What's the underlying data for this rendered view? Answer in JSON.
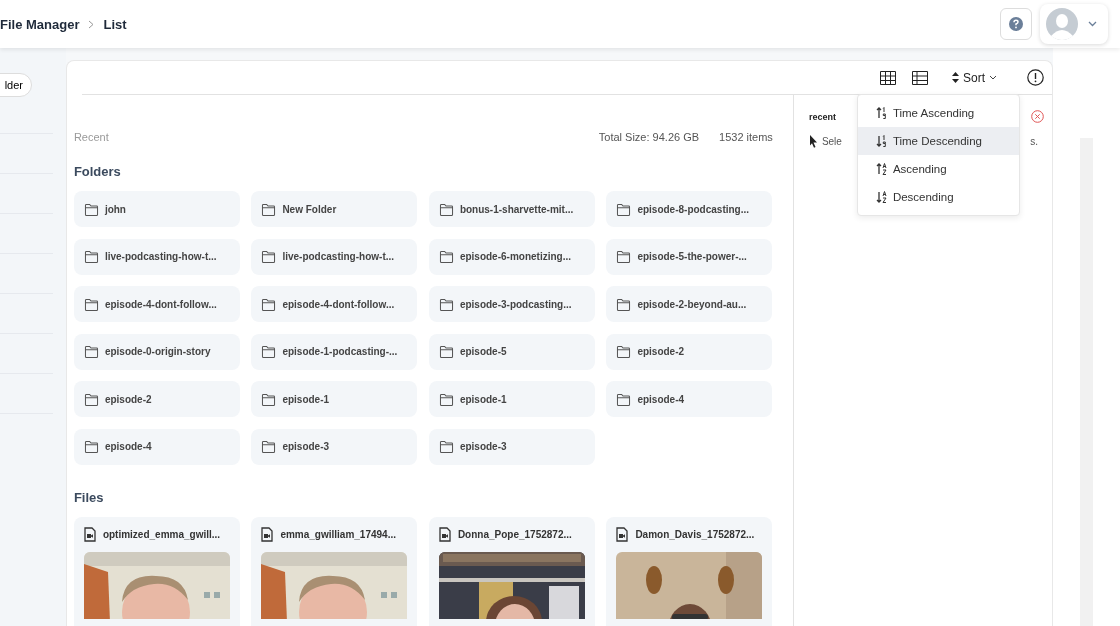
{
  "breadcrumb": [
    "File Manager",
    "List"
  ],
  "sidebar": {
    "new_button": "lder"
  },
  "toolbar": {
    "sort_label": "Sort"
  },
  "sort_menu": [
    {
      "label": "Time Ascending",
      "kind": "time-up",
      "highlighted": false
    },
    {
      "label": "Time Descending",
      "kind": "time-down",
      "highlighted": true
    },
    {
      "label": "Ascending",
      "kind": "alpha-up",
      "highlighted": false
    },
    {
      "label": "Descending",
      "kind": "alpha-down",
      "highlighted": false
    }
  ],
  "content": {
    "location": "Recent",
    "total_size": "Total Size: 94.26 GB",
    "item_count": "1532 items",
    "folders_title": "Folders",
    "files_title": "Files"
  },
  "folders": [
    "john",
    "New Folder",
    "bonus-1-sharvette-mit...",
    "episode-8-podcasting...",
    "live-podcasting-how-t...",
    "live-podcasting-how-t...",
    "episode-6-monetizing...",
    "episode-5-the-power-...",
    "episode-4-dont-follow...",
    "episode-4-dont-follow...",
    "episode-3-podcasting...",
    "episode-2-beyond-au...",
    "episode-0-origin-story",
    "episode-1-podcasting-...",
    "episode-5",
    "episode-2",
    "episode-2",
    "episode-1",
    "episode-1",
    "episode-4",
    "episode-4",
    "episode-3",
    "episode-3"
  ],
  "files": [
    {
      "name": "optimized_emma_gwill...",
      "kind": "picture"
    },
    {
      "name": "emma_gwilliam_17494...",
      "kind": "picture"
    },
    {
      "name": "Donna_Pope_1752872...",
      "kind": "picture"
    },
    {
      "name": "Damon_Davis_1752872...",
      "kind": "picture"
    }
  ],
  "details": {
    "title": "recent",
    "hint_start": "Sele",
    "hint_end": "s."
  }
}
